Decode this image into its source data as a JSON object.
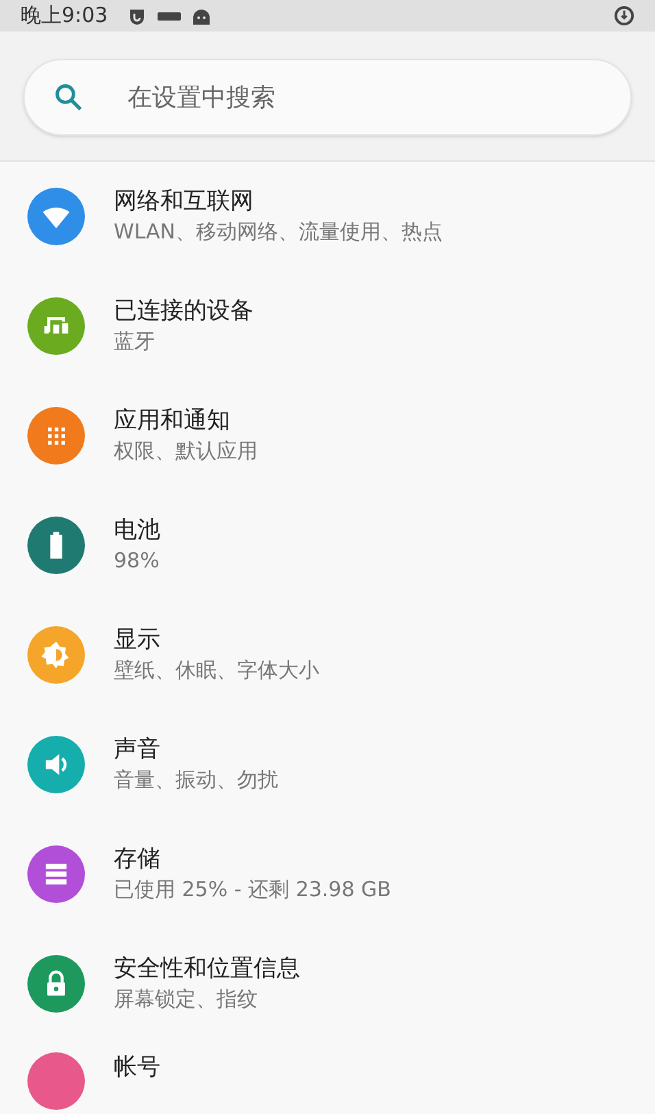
{
  "status_bar": {
    "time": "晚上9:03"
  },
  "search": {
    "placeholder": "在设置中搜索"
  },
  "items": [
    {
      "title": "网络和互联网",
      "subtitle": "WLAN、移动网络、流量使用、热点",
      "color": "#2f8ee8"
    },
    {
      "title": "已连接的设备",
      "subtitle": "蓝牙",
      "color": "#6aab1f"
    },
    {
      "title": "应用和通知",
      "subtitle": "权限、默认应用",
      "color": "#f07a1c"
    },
    {
      "title": "电池",
      "subtitle": "98%",
      "color": "#1f7b72"
    },
    {
      "title": "显示",
      "subtitle": "壁纸、休眠、字体大小",
      "color": "#f5a52a"
    },
    {
      "title": "声音",
      "subtitle": "音量、振动、勿扰",
      "color": "#16adad"
    },
    {
      "title": "存储",
      "subtitle": "已使用 25% - 还剩 23.98 GB",
      "color": "#b24fd8"
    },
    {
      "title": "安全性和位置信息",
      "subtitle": "屏幕锁定、指纹",
      "color": "#1d995e"
    },
    {
      "title": "帐号",
      "color": "#e9588b"
    }
  ]
}
